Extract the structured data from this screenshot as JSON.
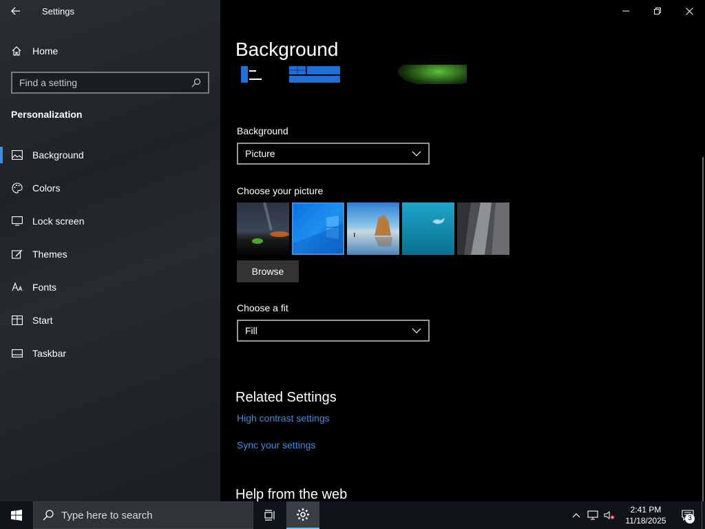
{
  "app": {
    "title": "Settings"
  },
  "sidebar": {
    "home_label": "Home",
    "search_placeholder": "Find a setting",
    "section_title": "Personalization",
    "items": [
      {
        "label": "Background",
        "icon": "picture-icon",
        "selected": true
      },
      {
        "label": "Colors",
        "icon": "palette-icon",
        "selected": false
      },
      {
        "label": "Lock screen",
        "icon": "lock-screen-icon",
        "selected": false
      },
      {
        "label": "Themes",
        "icon": "themes-icon",
        "selected": false
      },
      {
        "label": "Fonts",
        "icon": "fonts-icon",
        "selected": false
      },
      {
        "label": "Start",
        "icon": "start-icon",
        "selected": false
      },
      {
        "label": "Taskbar",
        "icon": "taskbar-icon",
        "selected": false
      }
    ]
  },
  "main": {
    "page_title": "Background",
    "background_label": "Background",
    "background_value": "Picture",
    "choose_picture_label": "Choose your picture",
    "browse_label": "Browse",
    "fit_label": "Choose a fit",
    "fit_value": "Fill",
    "related_title": "Related Settings",
    "links": [
      "High contrast settings",
      "Sync your settings"
    ],
    "help_title": "Help from the web"
  },
  "taskbar": {
    "search_placeholder": "Type here to search",
    "time": "2:41 PM",
    "date": "11/18/2025",
    "notification_count": "3"
  },
  "colors": {
    "accent": "#3b8ee0",
    "link": "#3b8ee0"
  }
}
